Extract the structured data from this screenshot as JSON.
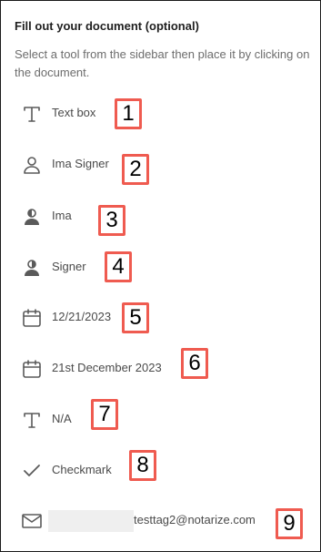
{
  "panel": {
    "title": "Fill out your document (optional)",
    "description": "Select a tool from the sidebar then place it by clicking on the document."
  },
  "tools": [
    {
      "label": "Text box",
      "icon": "text-icon",
      "badge": "1"
    },
    {
      "label": "Ima Signer",
      "icon": "user-icon",
      "badge": "2"
    },
    {
      "label": "Ima",
      "icon": "user-first-name-icon",
      "badge": "3"
    },
    {
      "label": "Signer",
      "icon": "user-last-name-icon",
      "badge": "4"
    },
    {
      "label": "12/21/2023",
      "icon": "calendar-icon",
      "badge": "5"
    },
    {
      "label": "21st December 2023",
      "icon": "calendar-icon",
      "badge": "6"
    },
    {
      "label": "N/A",
      "icon": "text-icon",
      "badge": "7"
    },
    {
      "label": "Checkmark",
      "icon": "checkmark-icon",
      "badge": "8"
    },
    {
      "label": "testtag2@notarize.com",
      "icon": "envelope-icon",
      "badge": "9"
    }
  ],
  "colors": {
    "badge_border": "#ef5b50",
    "icon": "#5a5a5a",
    "label": "#4a4a4a"
  }
}
